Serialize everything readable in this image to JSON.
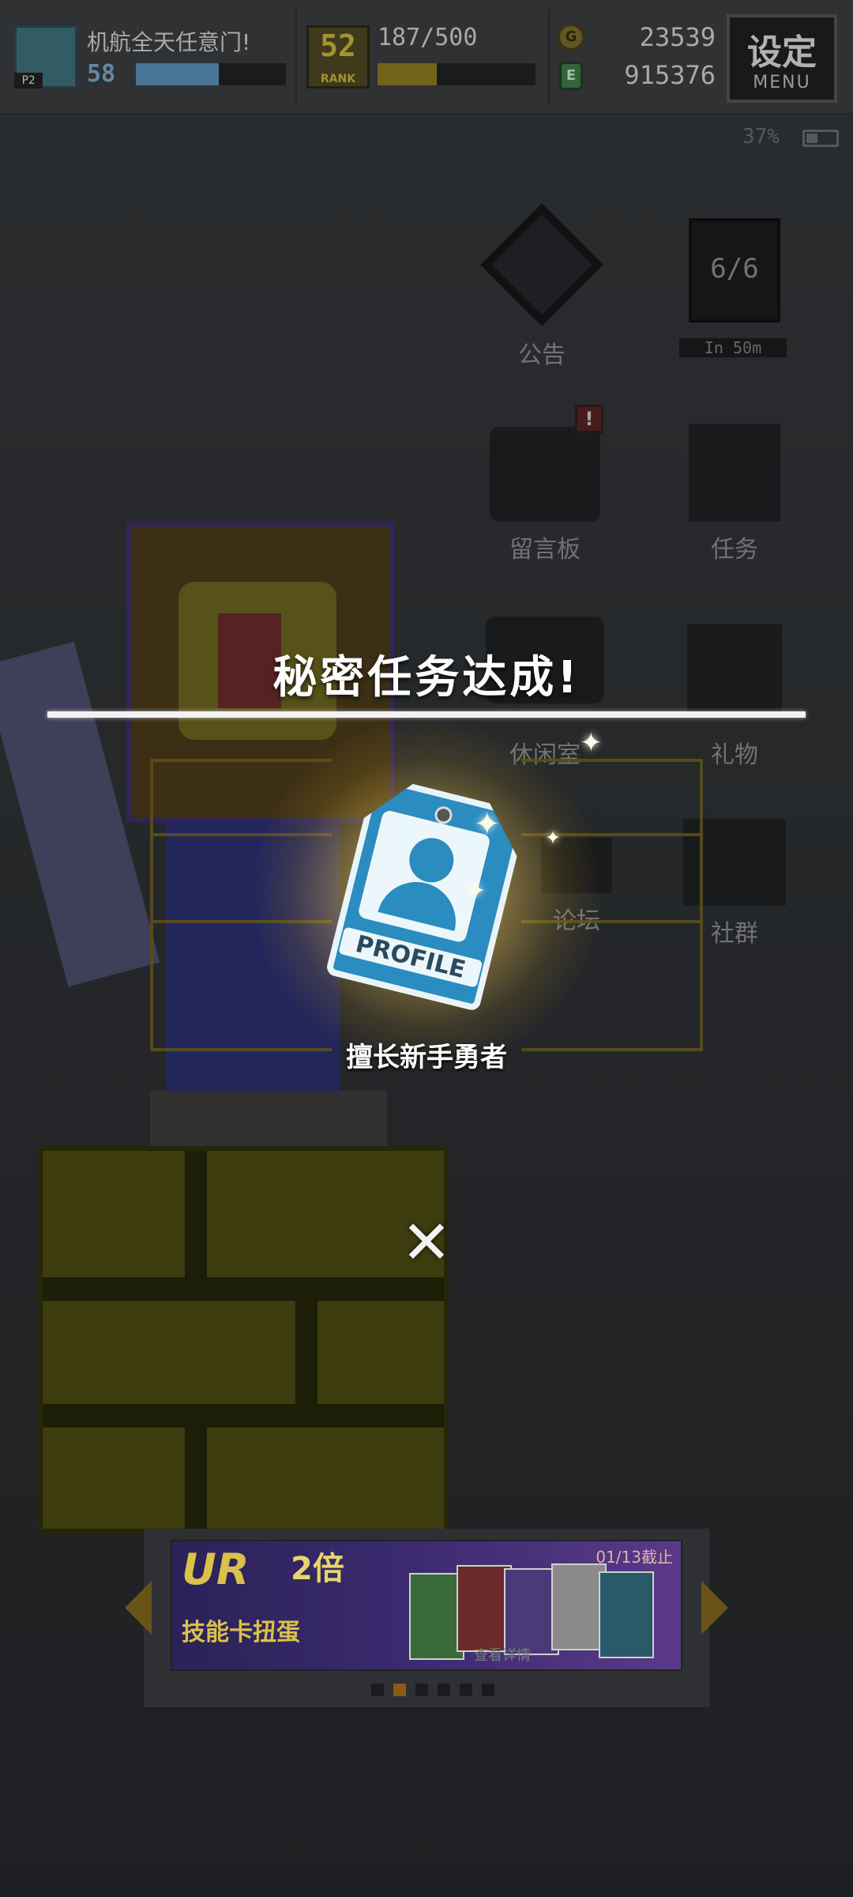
{
  "hud": {
    "player_name": "机航全天任意门!",
    "player_level": "58",
    "level_progress": 0.55,
    "rank_number": "52",
    "rank_label": "RANK",
    "exp_text": "187/500",
    "exp_progress": 0.374,
    "coins": "23539",
    "gems": "915376",
    "coin_icon": "G",
    "gem_icon": "E",
    "menu_label": "设定",
    "menu_sub": "MENU",
    "avatar_tag": "P2",
    "battery": "37%"
  },
  "side_menu": {
    "announcement": "公告",
    "stamina": "6/6",
    "stamina_timer": "In 50m",
    "message_board": "留言板",
    "alert_badge": "!",
    "missions": "任务",
    "lounge": "休闲室",
    "gifts": "礼物",
    "forum": "论坛",
    "community": "社群"
  },
  "popup": {
    "title": "秘密任务达成!",
    "badge_label": "PROFILE",
    "achievement_name": "擅长新手勇者",
    "close_symbol": "✕"
  },
  "banner": {
    "ur_text": "UR",
    "multiplier": "2倍",
    "subtitle": "技能卡扭蛋",
    "date": "01/13截止",
    "link": "查看详情",
    "dot_count": 6,
    "active_dot": 1
  },
  "colors": {
    "accent_gold": "#d9c14a",
    "level_bar": "#5a8fb8",
    "exp_bar": "#8a7a1e",
    "badge_blue": "#2a8cbf"
  }
}
